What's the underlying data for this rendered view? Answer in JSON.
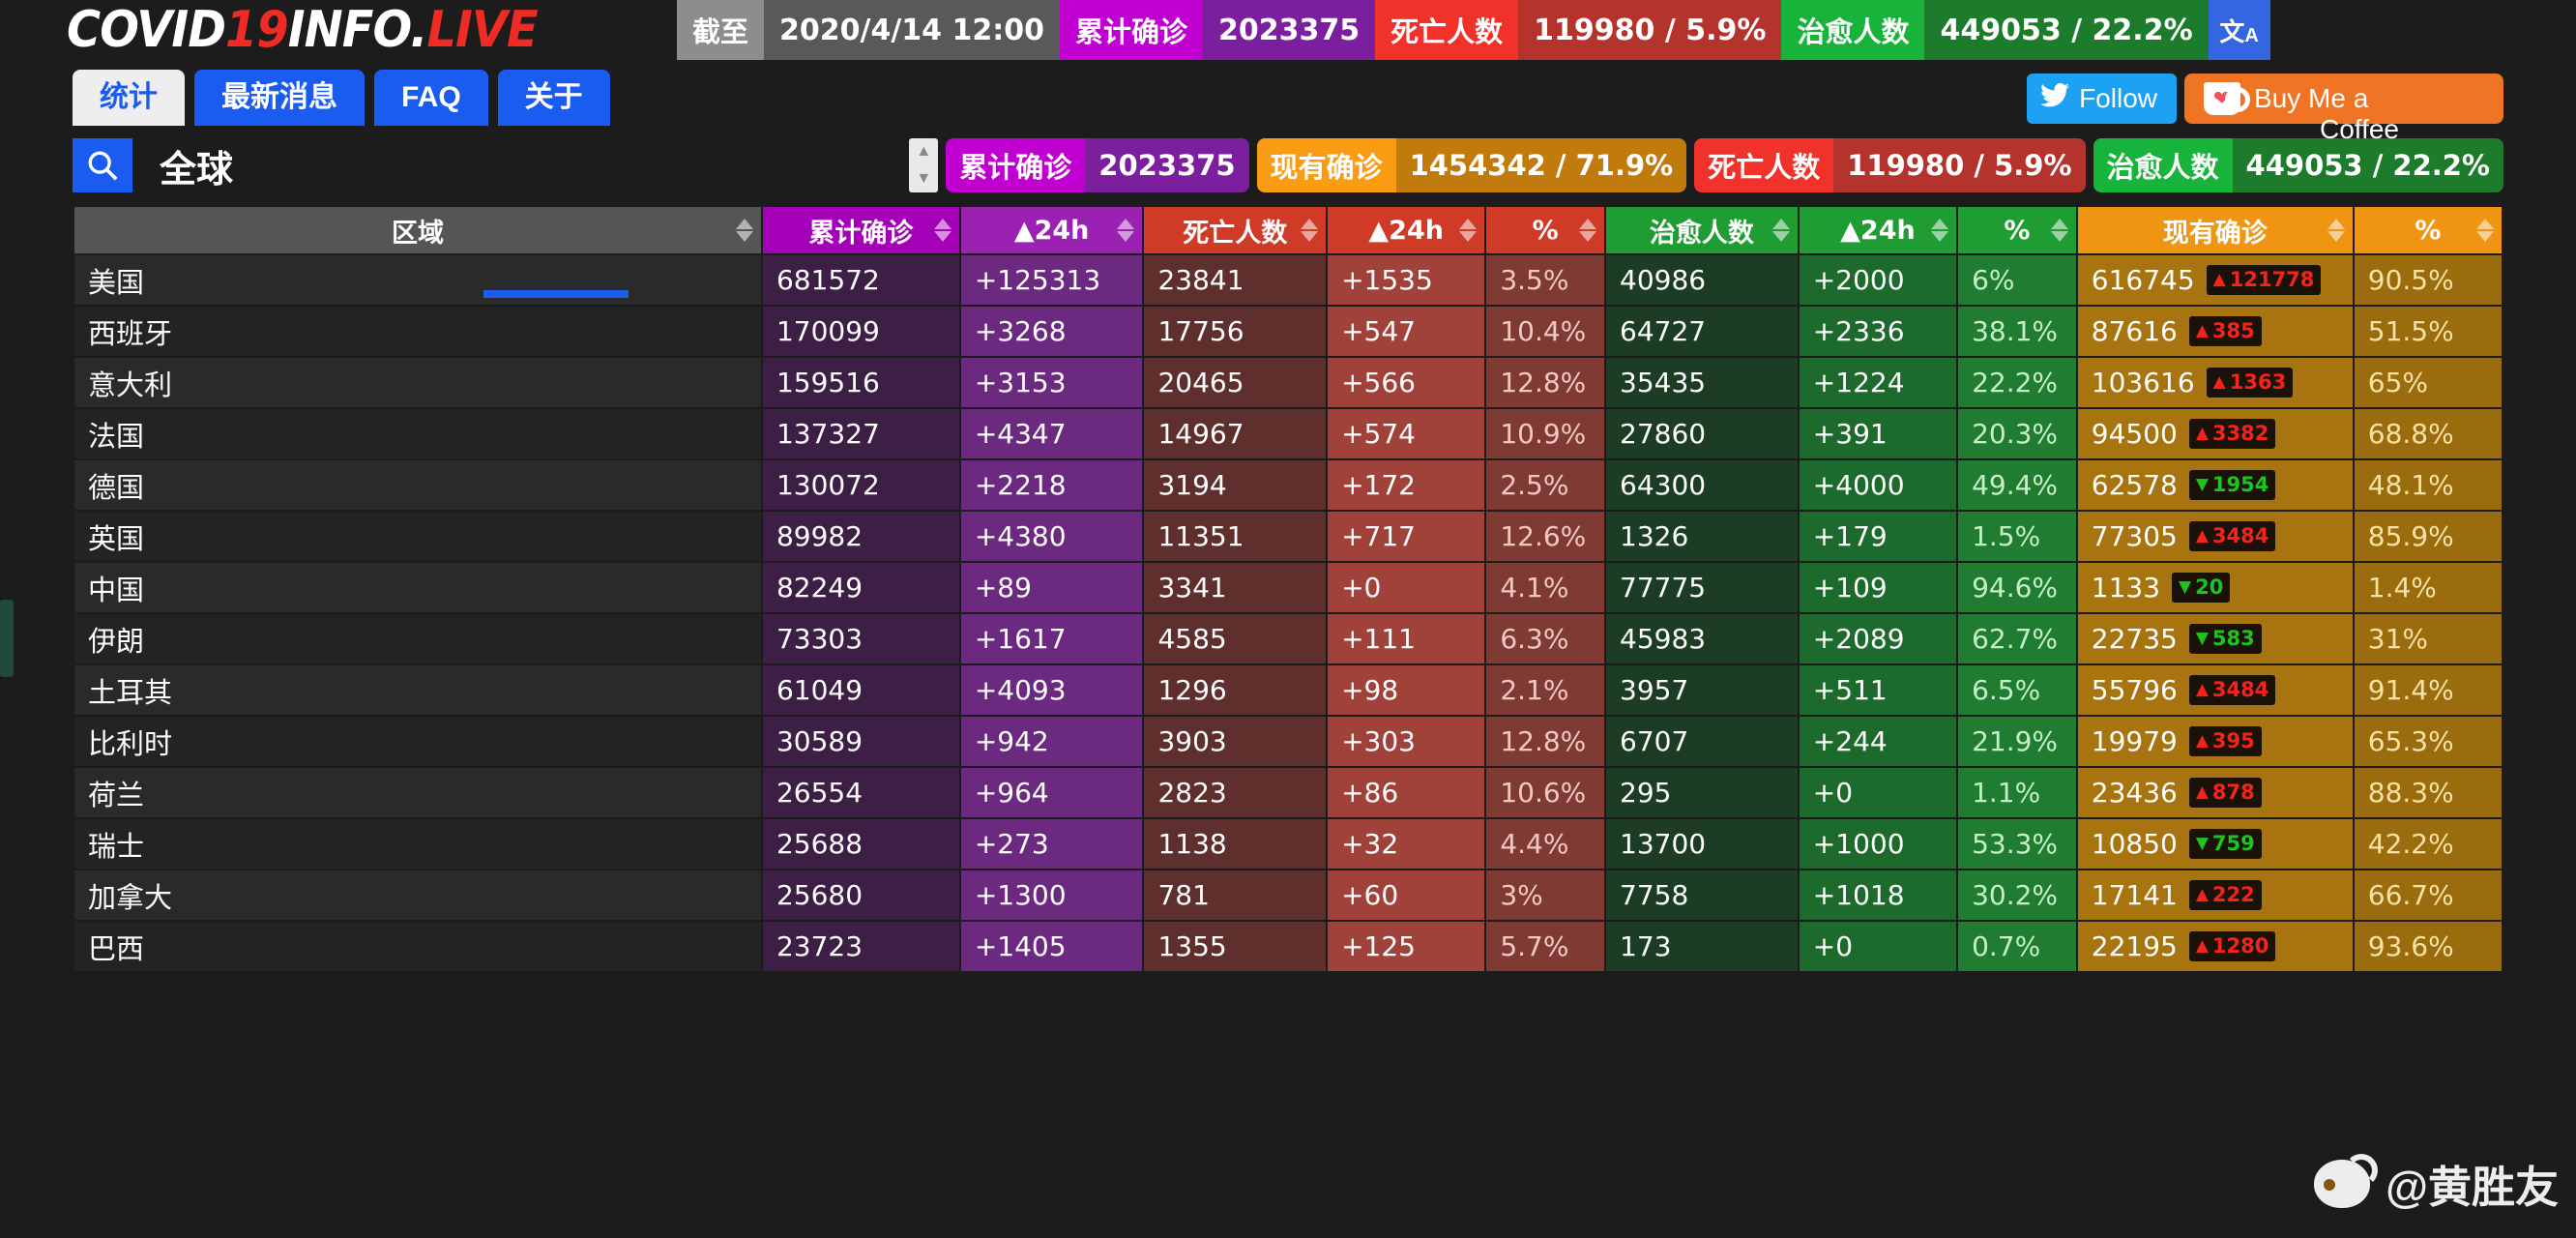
{
  "site": {
    "logo_part1": "COVID",
    "logo_part2": "19",
    "logo_part3": "INFO.",
    "logo_part4": "LIVE"
  },
  "topbar": {
    "asof_label": "截至",
    "asof_value": "2020/4/14 12:00",
    "confirmed_label": "累计确诊",
    "confirmed_value": "2023375",
    "deaths_label": "死亡人数",
    "deaths_value": "119980 / 5.9%",
    "recovered_label": "治愈人数",
    "recovered_value": "449053 / 22.2%",
    "translate_icon": "translate-icon",
    "translate_glyph_cn": "文",
    "translate_glyph_a": "A"
  },
  "nav": {
    "tabs": [
      {
        "label": "统计",
        "active": true
      },
      {
        "label": "最新消息",
        "active": false
      },
      {
        "label": "FAQ",
        "active": false
      },
      {
        "label": "关于",
        "active": false
      }
    ],
    "twitter_label": "Follow",
    "bmc_label": "Buy Me a",
    "bmc_label2": "Coffee"
  },
  "region_row": {
    "search_icon": "search-icon",
    "region_name": "全球",
    "summary": [
      {
        "label": "累计确诊",
        "value": "2023375",
        "color": "magenta"
      },
      {
        "label": "现有确诊",
        "value": "1454342 / 71.9%",
        "color": "orange"
      },
      {
        "label": "死亡人数",
        "value": "119980 / 5.9%",
        "color": "red"
      },
      {
        "label": "治愈人数",
        "value": "449053 / 22.2%",
        "color": "green"
      }
    ]
  },
  "table": {
    "headers": [
      {
        "label": "区域",
        "key": "region"
      },
      {
        "label": "累计确诊",
        "key": "confirmed"
      },
      {
        "label": "▲24h",
        "key": "confirmed24"
      },
      {
        "label": "死亡人数",
        "key": "deaths"
      },
      {
        "label": "▲24h",
        "key": "deaths24"
      },
      {
        "label": "%",
        "key": "death_pct"
      },
      {
        "label": "治愈人数",
        "key": "recovered"
      },
      {
        "label": "▲24h",
        "key": "recovered24"
      },
      {
        "label": "%",
        "key": "recovered_pct"
      },
      {
        "label": "现有确诊",
        "key": "active"
      },
      {
        "label": "%",
        "key": "active_pct"
      }
    ],
    "rows": [
      {
        "region": "美国",
        "confirmed": "681572",
        "confirmed24": "+125313",
        "deaths": "23841",
        "deaths24": "+1535",
        "death_pct": "3.5%",
        "recovered": "40986",
        "recovered24": "+2000",
        "recovered_pct": "6%",
        "active": "616745",
        "active_delta": "121778",
        "active_dir": "up",
        "active_pct": "90.5%"
      },
      {
        "region": "西班牙",
        "confirmed": "170099",
        "confirmed24": "+3268",
        "deaths": "17756",
        "deaths24": "+547",
        "death_pct": "10.4%",
        "recovered": "64727",
        "recovered24": "+2336",
        "recovered_pct": "38.1%",
        "active": "87616",
        "active_delta": "385",
        "active_dir": "up",
        "active_pct": "51.5%"
      },
      {
        "region": "意大利",
        "confirmed": "159516",
        "confirmed24": "+3153",
        "deaths": "20465",
        "deaths24": "+566",
        "death_pct": "12.8%",
        "recovered": "35435",
        "recovered24": "+1224",
        "recovered_pct": "22.2%",
        "active": "103616",
        "active_delta": "1363",
        "active_dir": "up",
        "active_pct": "65%"
      },
      {
        "region": "法国",
        "confirmed": "137327",
        "confirmed24": "+4347",
        "deaths": "14967",
        "deaths24": "+574",
        "death_pct": "10.9%",
        "recovered": "27860",
        "recovered24": "+391",
        "recovered_pct": "20.3%",
        "active": "94500",
        "active_delta": "3382",
        "active_dir": "up",
        "active_pct": "68.8%"
      },
      {
        "region": "德国",
        "confirmed": "130072",
        "confirmed24": "+2218",
        "deaths": "3194",
        "deaths24": "+172",
        "death_pct": "2.5%",
        "recovered": "64300",
        "recovered24": "+4000",
        "recovered_pct": "49.4%",
        "active": "62578",
        "active_delta": "1954",
        "active_dir": "down",
        "active_pct": "48.1%"
      },
      {
        "region": "英国",
        "confirmed": "89982",
        "confirmed24": "+4380",
        "deaths": "11351",
        "deaths24": "+717",
        "death_pct": "12.6%",
        "recovered": "1326",
        "recovered24": "+179",
        "recovered_pct": "1.5%",
        "active": "77305",
        "active_delta": "3484",
        "active_dir": "up",
        "active_pct": "85.9%"
      },
      {
        "region": "中国",
        "confirmed": "82249",
        "confirmed24": "+89",
        "deaths": "3341",
        "deaths24": "+0",
        "death_pct": "4.1%",
        "recovered": "77775",
        "recovered24": "+109",
        "recovered_pct": "94.6%",
        "active": "1133",
        "active_delta": "20",
        "active_dir": "down",
        "active_pct": "1.4%"
      },
      {
        "region": "伊朗",
        "confirmed": "73303",
        "confirmed24": "+1617",
        "deaths": "4585",
        "deaths24": "+111",
        "death_pct": "6.3%",
        "recovered": "45983",
        "recovered24": "+2089",
        "recovered_pct": "62.7%",
        "active": "22735",
        "active_delta": "583",
        "active_dir": "down",
        "active_pct": "31%"
      },
      {
        "region": "土耳其",
        "confirmed": "61049",
        "confirmed24": "+4093",
        "deaths": "1296",
        "deaths24": "+98",
        "death_pct": "2.1%",
        "recovered": "3957",
        "recovered24": "+511",
        "recovered_pct": "6.5%",
        "active": "55796",
        "active_delta": "3484",
        "active_dir": "up",
        "active_pct": "91.4%"
      },
      {
        "region": "比利时",
        "confirmed": "30589",
        "confirmed24": "+942",
        "deaths": "3903",
        "deaths24": "+303",
        "death_pct": "12.8%",
        "recovered": "6707",
        "recovered24": "+244",
        "recovered_pct": "21.9%",
        "active": "19979",
        "active_delta": "395",
        "active_dir": "up",
        "active_pct": "65.3%"
      },
      {
        "region": "荷兰",
        "confirmed": "26554",
        "confirmed24": "+964",
        "deaths": "2823",
        "deaths24": "+86",
        "death_pct": "10.6%",
        "recovered": "295",
        "recovered24": "+0",
        "recovered_pct": "1.1%",
        "active": "23436",
        "active_delta": "878",
        "active_dir": "up",
        "active_pct": "88.3%"
      },
      {
        "region": "瑞士",
        "confirmed": "25688",
        "confirmed24": "+273",
        "deaths": "1138",
        "deaths24": "+32",
        "death_pct": "4.4%",
        "recovered": "13700",
        "recovered24": "+1000",
        "recovered_pct": "53.3%",
        "active": "10850",
        "active_delta": "759",
        "active_dir": "down",
        "active_pct": "42.2%"
      },
      {
        "region": "加拿大",
        "confirmed": "25680",
        "confirmed24": "+1300",
        "deaths": "781",
        "deaths24": "+60",
        "death_pct": "3%",
        "recovered": "7758",
        "recovered24": "+1018",
        "recovered_pct": "30.2%",
        "active": "17141",
        "active_delta": "222",
        "active_dir": "up",
        "active_pct": "66.7%"
      },
      {
        "region": "巴西",
        "confirmed": "23723",
        "confirmed24": "+1405",
        "deaths": "1355",
        "deaths24": "+125",
        "death_pct": "5.7%",
        "recovered": "173",
        "recovered24": "+0",
        "recovered_pct": "0.7%",
        "active": "22195",
        "active_delta": "1280",
        "active_dir": "up",
        "active_pct": "93.6%"
      }
    ]
  },
  "watermark": {
    "icon": "weibo-icon",
    "handle": "@黄胜友"
  }
}
